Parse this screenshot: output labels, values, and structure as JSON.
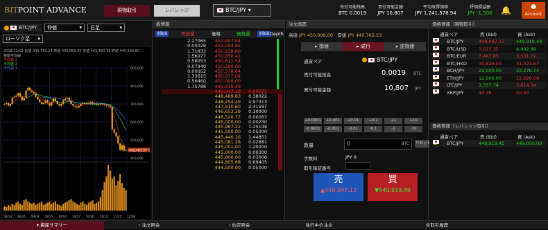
{
  "header": {
    "logo_a": "BIT",
    "logo_b": "POINT ADVANCE",
    "spot_label": "現物取引",
    "leverage_label": "レバレッジ",
    "pair": "BTC/JPY",
    "stats": [
      {
        "label": "売付可能残高",
        "value": "BTC 0.0019"
      },
      {
        "label": "買付可能金額",
        "value": "JPY 10,807"
      },
      {
        "label": "平均取得価格",
        "value": "JPY 1,241,578.94"
      },
      {
        "label": "評価損益額",
        "value": "JPY -1,506"
      }
    ],
    "account": "Account"
  },
  "left": {
    "pair": "BTC/JPY",
    "price_type": "仲値",
    "period": "日足",
    "chart_type": "ローソク足"
  },
  "chart_data": {
    "type": "candlestick",
    "title": "",
    "date": "2018/12/02",
    "ohlc": [
      "445,783.14",
      "445,850.35",
      "443,483.31",
      "445,504.60"
    ],
    "ma_labels": [
      "移動平均線",
      "平均値 1",
      "平均値 2",
      "平均値 3"
    ],
    "y_ticks": [
      "900,000",
      "800,000",
      "700,000",
      "600,000",
      "500,000",
      "400,000"
    ],
    "last_price": "445,483.37",
    "x_labels": [
      "08/13",
      "08/26",
      "09/08",
      "09/21",
      "10/04",
      "10/17",
      "10/30",
      "11/12",
      "11/25",
      "12/08"
    ],
    "closes": [
      700,
      705,
      690,
      700,
      735,
      740,
      745,
      760,
      740,
      720,
      735,
      775,
      790,
      775,
      765,
      760,
      740,
      725,
      710,
      700,
      705,
      720,
      705,
      690,
      710,
      730,
      715,
      700,
      690,
      700,
      720,
      730,
      735,
      720,
      700,
      690,
      685,
      680,
      690,
      700,
      705,
      700,
      705,
      700,
      710,
      700,
      705,
      695,
      700,
      700,
      700,
      695,
      690,
      690,
      680,
      560,
      540,
      520,
      480,
      445,
      470,
      440,
      445
    ],
    "volumes": [
      4,
      3,
      5,
      4,
      6,
      5,
      7,
      8,
      6,
      5,
      9,
      10,
      8,
      7,
      6,
      7,
      5,
      6,
      7,
      8,
      5,
      6,
      7,
      8,
      6,
      7,
      8,
      6,
      5,
      4,
      6,
      7,
      8,
      9,
      10,
      8,
      7,
      6,
      5,
      7,
      8,
      6,
      5,
      7,
      8,
      9,
      6,
      7,
      8,
      12,
      18,
      25,
      30,
      40,
      35,
      28,
      30,
      22,
      26,
      32,
      24,
      20,
      18
    ]
  },
  "book": {
    "title": "板情報",
    "ask_label": "売数量",
    "price_label": "価格",
    "bid_label": "買数量",
    "depth_label": "Depth",
    "cancel_all": "全取消",
    "asks": [
      {
        "q": "2.27065",
        "p": "451,997.04"
      },
      {
        "q": "0.00029",
        "p": "451,384.85"
      },
      {
        "q": "1.71833",
        "p": "450,938.80"
      },
      {
        "q": "1.56077",
        "p": "450,650.41"
      },
      {
        "q": "0.56053",
        "p": "450,611.54"
      },
      {
        "q": "0.07940",
        "p": "450,500.00"
      },
      {
        "q": "0.00052",
        "p": "450,378.64"
      },
      {
        "q": "1.33615",
        "p": "450,077.04"
      },
      {
        "q": "0.56460",
        "p": "450,000.00"
      },
      {
        "q": "1.75786",
        "p": "449,919.49"
      }
    ],
    "mid": "449,047.13",
    "mid_q": "0.00075",
    "bids": [
      {
        "p": "448,489.83",
        "q": "0.38022"
      },
      {
        "p": "448,254.49",
        "q": "4.97313"
      },
      {
        "p": "447,510.60",
        "q": "2.41587"
      },
      {
        "p": "446,653.39",
        "q": "0.10000"
      },
      {
        "p": "446,520.77",
        "q": "0.00067"
      },
      {
        "p": "446,000.00",
        "q": "0.00230"
      },
      {
        "p": "445,967.22",
        "q": "1.25148"
      },
      {
        "p": "445,500.00",
        "q": "0.05000"
      },
      {
        "p": "445,440.16",
        "q": "1.44851"
      },
      {
        "p": "445,081.28",
        "q": "0.02881"
      },
      {
        "p": "445,001.00",
        "q": "1.20000"
      },
      {
        "p": "445,000.00",
        "q": "0.00300"
      },
      {
        "p": "445,000.00",
        "q": "0.03000"
      },
      {
        "p": "444,805.68",
        "q": "0.69405"
      },
      {
        "p": "444,500.00",
        "q": "0.05000"
      }
    ]
  },
  "order": {
    "title": "注文画面",
    "high_label": "高値",
    "high": "JPY 450,000.00",
    "low_label": "安値",
    "low": "JPY 445,765.53",
    "tabs": [
      "指値",
      "成行",
      "逆指値"
    ],
    "pair_label": "通貨ペア",
    "pair": "BTC/JPY",
    "sell_avail_label": "売付可能残高",
    "sell_avail": "0.0019",
    "sell_unit": "BTC",
    "buy_avail_label": "買付可能金額",
    "buy_avail": "10,807",
    "buy_unit": "JPY",
    "plus": [
      "+0.0001",
      "+0.001",
      "+0.01",
      "+0.1",
      "+1",
      "+10"
    ],
    "minus": [
      "-0.0001",
      "-0.001",
      "-0.01",
      "-0.1",
      "-1",
      "-10"
    ],
    "qty_label": "数量",
    "qty": "0",
    "qty_unit": "BTC",
    "reset": "リセット",
    "fee_label": "手数料",
    "fee": "JPY 0",
    "pin_label": "取引暗証番号",
    "sell_label": "売",
    "sell_price": "449,047.13",
    "buy_label": "買",
    "buy_price": "449,919.49"
  },
  "rates": {
    "title": "価格情報（現物取引）",
    "h_pair": "通貨ペア",
    "h_bid": "売 (Bid)",
    "h_ask": "買 (Ask)",
    "rows": [
      {
        "pair": "BTC/JPY",
        "bid": "449,047.13",
        "ask": "449,919.49",
        "bc": "dn",
        "ac": "up",
        "icon": "jp"
      },
      {
        "pair": "BTC/USD",
        "bid": "3,915.35",
        "ask": "4,002.99",
        "bc": "dn",
        "ac": "up",
        "icon": "us"
      },
      {
        "pair": "BTC/EUR",
        "bid": "3,467.85",
        "ask": "3,531.72",
        "bc": "dn",
        "ac": "dn",
        "icon": "eu"
      },
      {
        "pair": "BTC/HKD",
        "bid": "30,826.03",
        "ask": "31,023.67",
        "bc": "dn",
        "ac": "dn",
        "icon": "hk"
      },
      {
        "pair": "BCH/JPY",
        "bid": "22,000.00",
        "ask": "22,270.74",
        "bc": "up",
        "ac": "up",
        "icon": "jp"
      },
      {
        "pair": "ETH/JPY",
        "bid": "12,500.00",
        "ask": "12,620.00",
        "bc": "up",
        "ac": "dn",
        "icon": "jp"
      },
      {
        "pair": "LTC/JPY",
        "bid": "3,557.74",
        "ask": "3,614.34",
        "bc": "up",
        "ac": "dn",
        "icon": "jp"
      },
      {
        "pair": "XRP/JPY",
        "bid": "40.36",
        "ask": "40.50",
        "bc": "dn",
        "ac": "dn",
        "icon": "jp"
      }
    ],
    "lev_title": "価格情報（レバレッジ取引）",
    "lev_row": {
      "pair": "BTC/JPY",
      "bid": "448,819.45",
      "ask": "449,000.00"
    }
  },
  "bottom": {
    "tabs": [
      "資産サマリー",
      "注文照会",
      "約定照会",
      "執行中の注文",
      "",
      "全取引履歴"
    ]
  }
}
